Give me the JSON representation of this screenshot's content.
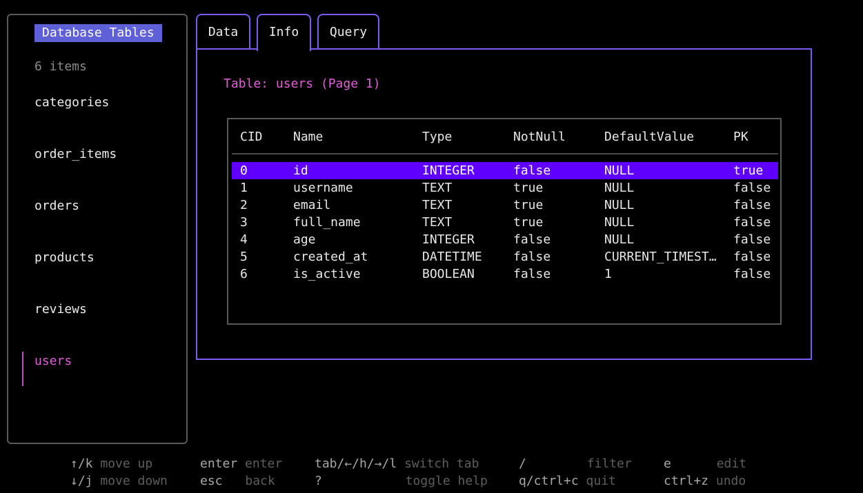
{
  "sidebar": {
    "title": "Database Tables",
    "count": "6 items",
    "items": [
      "categories",
      "order_items",
      "orders",
      "products",
      "reviews",
      "users"
    ],
    "selected": "users"
  },
  "tabs": [
    {
      "label": "Data",
      "active": false
    },
    {
      "label": "Info",
      "active": true
    },
    {
      "label": "Query",
      "active": false
    }
  ],
  "main": {
    "heading": "Table: users (Page 1)",
    "columns": [
      "CID",
      "Name",
      "Type",
      "NotNull",
      "DefaultValue",
      "PK"
    ],
    "rows": [
      [
        "0",
        "id",
        "INTEGER",
        "false",
        "NULL",
        "true"
      ],
      [
        "1",
        "username",
        "TEXT",
        "true",
        "NULL",
        "false"
      ],
      [
        "2",
        "email",
        "TEXT",
        "true",
        "NULL",
        "false"
      ],
      [
        "3",
        "full_name",
        "TEXT",
        "true",
        "NULL",
        "false"
      ],
      [
        "4",
        "age",
        "INTEGER",
        "false",
        "NULL",
        "false"
      ],
      [
        "5",
        "created_at",
        "DATETIME",
        "false",
        "CURRENT_TIMEST…",
        "false"
      ],
      [
        "6",
        "is_active",
        "BOOLEAN",
        "false",
        "1",
        "false"
      ]
    ],
    "selected_row": 0
  },
  "help": [
    {
      "key": "↑/k",
      "desc": "move up"
    },
    {
      "key": "↓/j",
      "desc": "move down"
    },
    {
      "key": "enter",
      "desc": "enter"
    },
    {
      "key": "esc",
      "desc": "back"
    },
    {
      "key": "tab/←/h/→/l",
      "desc": "switch tab"
    },
    {
      "key": "?",
      "desc": "toggle help"
    },
    {
      "key": "/",
      "desc": "filter"
    },
    {
      "key": "q/ctrl+c",
      "desc": "quit"
    },
    {
      "key": "e",
      "desc": "edit"
    },
    {
      "key": "ctrl+z",
      "desc": "undo"
    }
  ],
  "colors": {
    "accent_border": "#7c5cf0",
    "title_bg": "#5f5fd7",
    "selected_text": "#e05fd7",
    "selected_row_bg": "#5f00ff"
  }
}
